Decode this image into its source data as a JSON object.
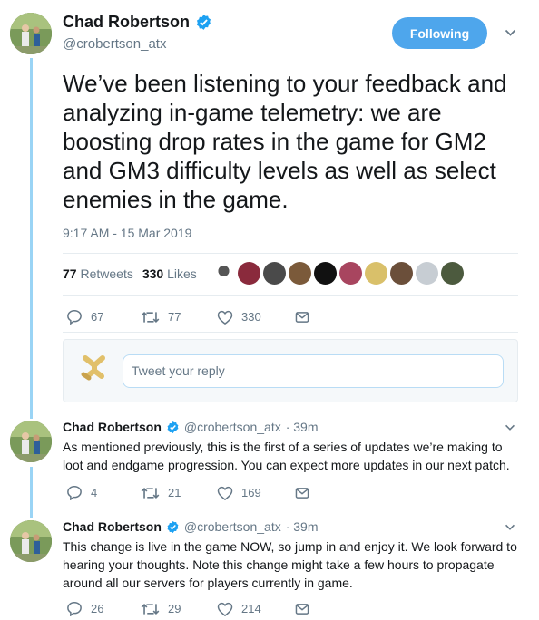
{
  "main_tweet": {
    "author_name": "Chad Robertson",
    "author_handle": "@crobertson_atx",
    "follow_label": "Following",
    "text": "We’ve been listening to your feedback and analyzing in-game telemetry: we are boosting drop rates in the game for GM2 and GM3 difficulty levels as well as select enemies in the game.",
    "timestamp": "9:17 AM - 15 Mar 2019",
    "retweets_count": "77",
    "retweets_label": "Retweets",
    "likes_count": "330",
    "likes_label": "Likes",
    "actions": {
      "replies": "67",
      "retweets": "77",
      "likes": "330"
    }
  },
  "reply_box": {
    "placeholder": "Tweet your reply"
  },
  "replies": [
    {
      "author_name": "Chad Robertson",
      "author_handle": "@crobertson_atx",
      "time": "· 39m",
      "text": "As mentioned previously, this is the first of a series of updates we’re making to loot and endgame progression. You can expect more updates in our next patch.",
      "actions": {
        "replies": "4",
        "retweets": "21",
        "likes": "169"
      }
    },
    {
      "author_name": "Chad Robertson",
      "author_handle": "@crobertson_atx",
      "time": "· 39m",
      "text": "This change is live in the game NOW, so jump in and enjoy it.  We look forward to hearing your thoughts. Note this change might take a few hours to propagate around all our servers for players currently in game.",
      "actions": {
        "replies": "26",
        "retweets": "29",
        "likes": "214"
      }
    }
  ],
  "colors": {
    "accent": "#1da1f2",
    "follow_button": "#4ea6ec",
    "thread_line": "#9ad4f5",
    "muted": "#657786"
  },
  "icons": [
    "verified-badge-icon",
    "chevron-down-icon",
    "reply-icon",
    "retweet-icon",
    "like-icon",
    "message-icon"
  ]
}
